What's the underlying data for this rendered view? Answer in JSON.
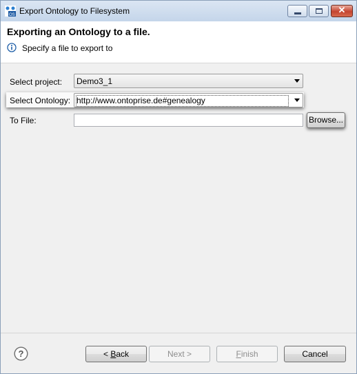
{
  "window": {
    "title": "Export Ontology to Filesystem",
    "close_glyph": "✕",
    "icons": {
      "app": "ontology-export-app-icon",
      "minimize": "minimize-icon",
      "maximize": "maximize-icon",
      "close": "close-icon"
    }
  },
  "header": {
    "title": "Exporting an Ontology to a file.",
    "description": "Specify a file to export to",
    "icon": "info-icon"
  },
  "form": {
    "project": {
      "label": "Select project:",
      "value": "Demo3_1"
    },
    "ontology": {
      "label": "Select Ontology:",
      "value": "http://www.ontoprise.de#genealogy"
    },
    "to_file": {
      "label": "To File:",
      "value": "",
      "browse_label": "Browse..."
    }
  },
  "footer": {
    "help_icon": "help-icon",
    "help_glyph": "?",
    "back_prefix": "< ",
    "back_key": "B",
    "back_rest": "ack",
    "next_label": "Next >",
    "finish_key": "F",
    "finish_rest": "inish",
    "cancel_label": "Cancel",
    "states": {
      "back": "enabled",
      "next": "disabled",
      "finish": "disabled",
      "cancel": "enabled"
    }
  },
  "colors": {
    "titlebar": "#c4d5ea",
    "close_button": "#c44430",
    "dialog_bg": "#f0f0f0",
    "info_blue": "#1f5fa8",
    "disabled_text": "#8d8d8d"
  }
}
